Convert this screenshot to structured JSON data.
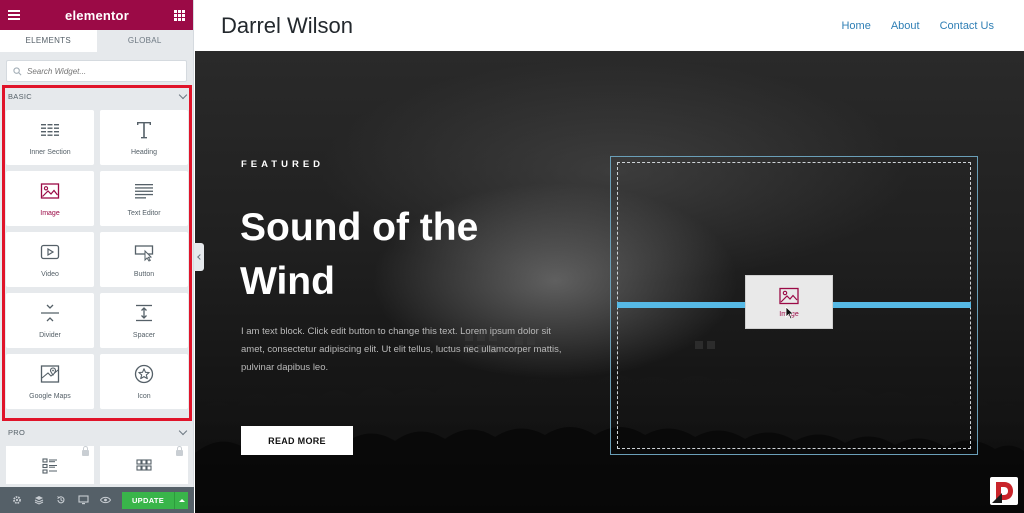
{
  "panel": {
    "logo": "elementor",
    "tabs": [
      {
        "label": "ELEMENTS"
      },
      {
        "label": "GLOBAL"
      }
    ],
    "search": {
      "placeholder": "Search Widget..."
    },
    "basic": {
      "header": "BASIC",
      "widgets": [
        {
          "label": "Inner Section",
          "icon": "inner-section-icon"
        },
        {
          "label": "Heading",
          "icon": "heading-icon"
        },
        {
          "label": "Image",
          "icon": "image-icon"
        },
        {
          "label": "Text Editor",
          "icon": "text-editor-icon"
        },
        {
          "label": "Video",
          "icon": "video-icon"
        },
        {
          "label": "Button",
          "icon": "button-icon"
        },
        {
          "label": "Divider",
          "icon": "divider-icon"
        },
        {
          "label": "Spacer",
          "icon": "spacer-icon"
        },
        {
          "label": "Google Maps",
          "icon": "google-maps-icon"
        },
        {
          "label": "Icon",
          "icon": "star-icon"
        }
      ]
    },
    "pro": {
      "header": "PRO"
    },
    "footer": {
      "update_label": "UPDATE"
    },
    "colors": {
      "brand": "#9b0a46",
      "update": "#39b54a",
      "highlight": "#e0142a"
    }
  },
  "site": {
    "title": "Darrel Wilson",
    "nav": [
      {
        "label": "Home"
      },
      {
        "label": "About"
      },
      {
        "label": "Contact Us"
      }
    ],
    "hero": {
      "featured": "FEATURED",
      "title": "Sound of the Wind",
      "text": "I am text block. Click edit button to change this text. Lorem ipsum dolor sit amet, consectetur adipiscing elit. Ut elit tellus, luctus nec ullamcorper mattis, pulvinar dapibus leo.",
      "button": "READ MORE"
    },
    "drag": {
      "label": "Image"
    },
    "colors": {
      "nav": "#2f7fb5",
      "drop_indicator": "#56b9e5"
    }
  }
}
